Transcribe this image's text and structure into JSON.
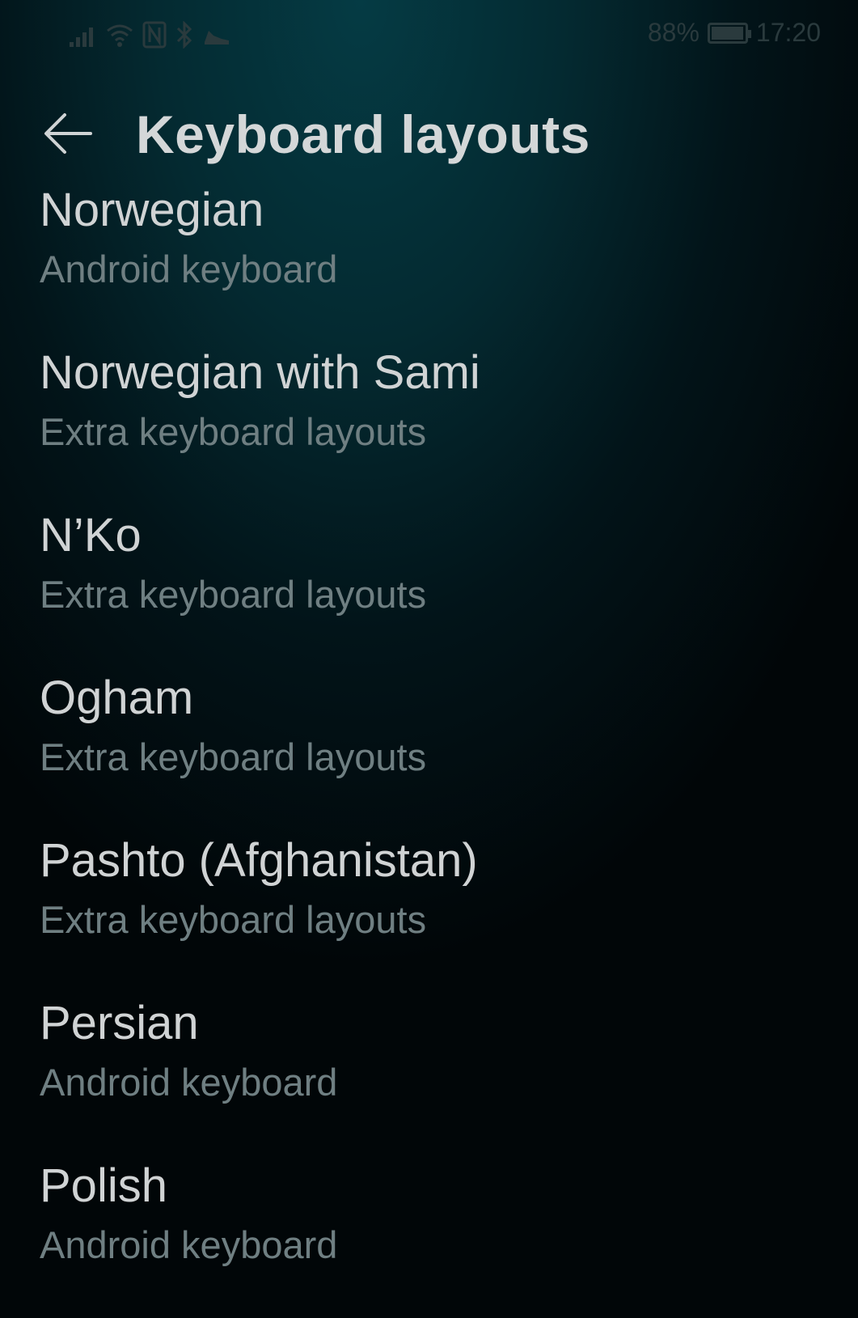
{
  "status_bar": {
    "battery_percent": "88%",
    "battery_level": 0.88,
    "time": "17:20",
    "icons": [
      "signal-icon",
      "wifi-icon",
      "nfc-icon",
      "bluetooth-icon",
      "shoe-icon"
    ]
  },
  "header": {
    "back_icon": "arrow-left-icon",
    "title": "Keyboard layouts"
  },
  "layouts": [
    {
      "name": "Norwegian",
      "source": "Android keyboard"
    },
    {
      "name": "Norwegian with Sami",
      "source": "Extra keyboard layouts"
    },
    {
      "name": "N’Ko",
      "source": "Extra keyboard layouts"
    },
    {
      "name": "Ogham",
      "source": "Extra keyboard layouts"
    },
    {
      "name": "Pashto (Afghanistan)",
      "source": "Extra keyboard layouts"
    },
    {
      "name": "Persian",
      "source": "Android keyboard"
    },
    {
      "name": "Polish",
      "source": "Android keyboard"
    }
  ],
  "colors": {
    "background_top": "#053b44",
    "background_bottom": "#010608",
    "title_text": "#d4d7d8",
    "subtitle_text": "#6f7f82"
  }
}
